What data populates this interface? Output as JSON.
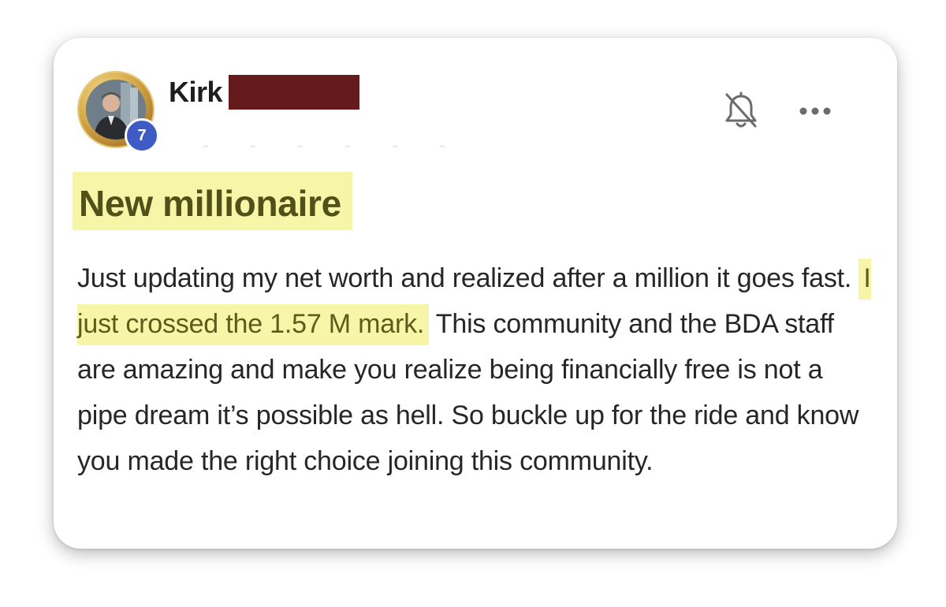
{
  "post": {
    "author_name": "Kirk",
    "level_badge": "7",
    "title": "New millionaire",
    "body": {
      "before_highlight": "Just updating my net worth and realized after a million it goes fast.",
      "highlight": "I just crossed the 1.57 M mark.",
      "after_highlight": "This community and the BDA staff are amazing and make you realize being financially free is not a pipe dream it’s possible as hell. So buckle up for the ride and know you made the right choice joining this community."
    }
  },
  "icons": {
    "notifications": "bell-off-icon",
    "more_options": "more-horizontal-icon"
  },
  "colors": {
    "highlight": "#f7f5a7",
    "redaction": "#651b1b",
    "badge": "#3f5bc4",
    "title_text": "#4f5118"
  }
}
